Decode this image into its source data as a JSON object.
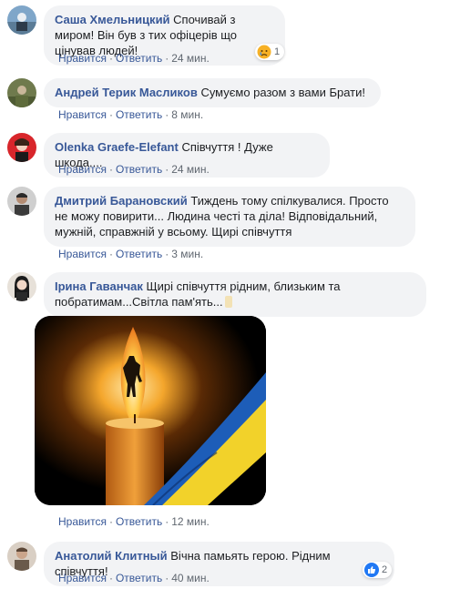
{
  "comments": [
    {
      "author": "Саша Хмельницкий",
      "text": "Спочивай з миром! Він був з тих офіцерів що цінував людей!",
      "like_label": "Нравится",
      "reply_label": "Ответить",
      "time": "24 мин.",
      "reaction_count": "1",
      "reaction_icon": "sad-face-icon"
    },
    {
      "author": "Андрей Терик Масликов",
      "text": "Сумуємо разом з вами Брати!",
      "like_label": "Нравится",
      "reply_label": "Ответить",
      "time": "8 мин."
    },
    {
      "author": "Olenka Graefe-Elefant",
      "text": "Співчуття ! Дуже шкода....",
      "like_label": "Нравится",
      "reply_label": "Ответить",
      "time": "24 мин."
    },
    {
      "author": "Дмитрий Барановский",
      "text": "Тиждень тому спілкувалися. Просто не можу повирити... Людина честі та діла! Відповідальний, мужній, справжній у всьому. Щирі співчуття",
      "like_label": "Нравится",
      "reply_label": "Ответить",
      "time": "3 мин."
    },
    {
      "author": "Ірина Гаванчак",
      "text": "Щирі співчуття рідним, близьким та побратимам...Світла пам'ять...",
      "like_label": "Нравится",
      "reply_label": "Ответить",
      "time": "12 мин."
    },
    {
      "author": "Анатолий Клитный",
      "text": "Вічна памьять герою. Рідним співчуття!",
      "like_label": "Нравится",
      "reply_label": "Ответить",
      "time": "40 мин.",
      "reaction_count": "2",
      "reaction_icon": "like-thumb-icon"
    }
  ],
  "separator": "·",
  "colors": {
    "author": "#385898",
    "bubble": "#f2f3f5",
    "meta": "#606770",
    "like_blue": "#2078f4",
    "sad_yellow": "#f7b125"
  }
}
